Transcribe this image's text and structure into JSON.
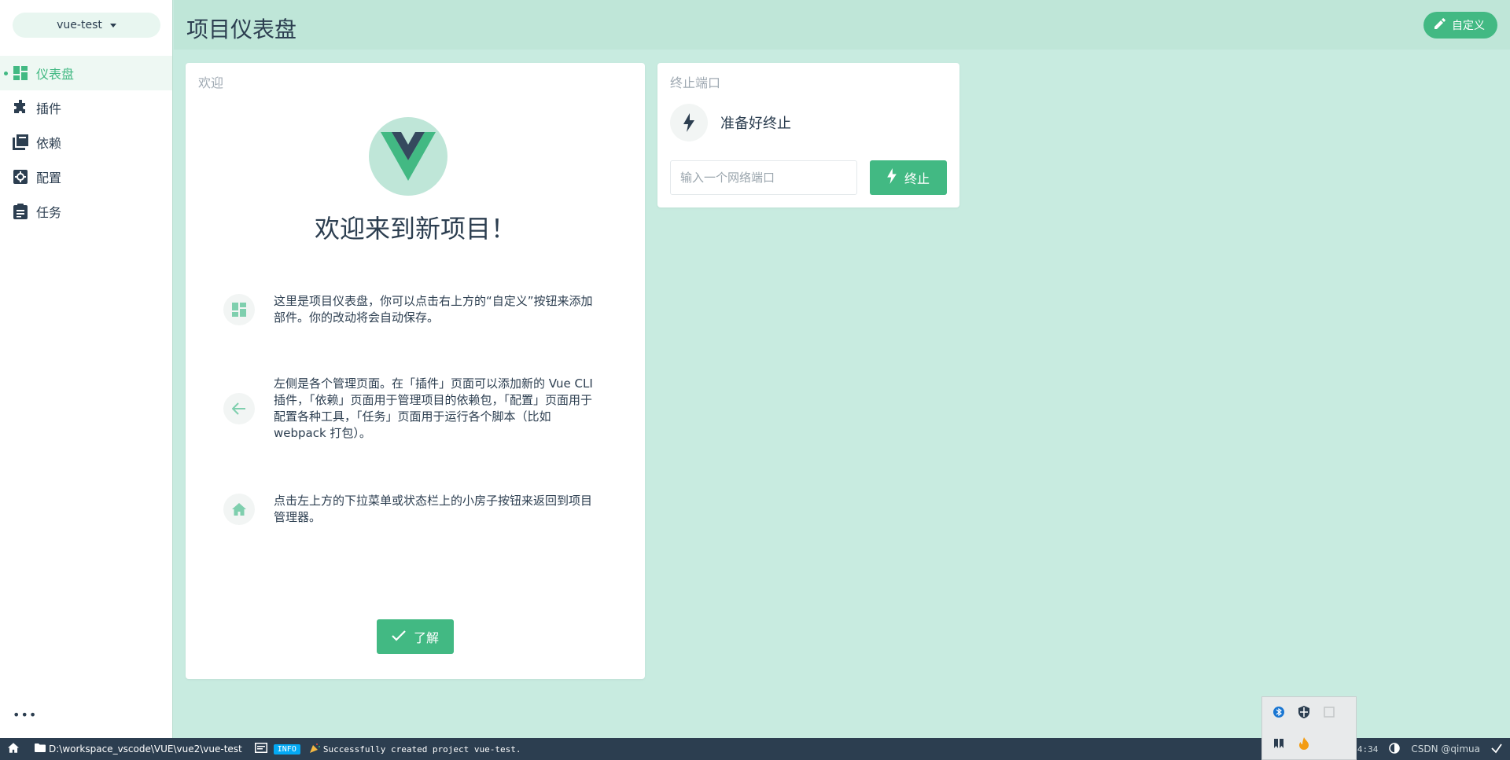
{
  "sidebar": {
    "project": "vue-test",
    "items": [
      {
        "label": "仪表盘",
        "icon": "dashboard-icon",
        "active": true
      },
      {
        "label": "插件",
        "icon": "puzzle-icon",
        "active": false
      },
      {
        "label": "依赖",
        "icon": "library-icon",
        "active": false
      },
      {
        "label": "配置",
        "icon": "settings-icon",
        "active": false
      },
      {
        "label": "任务",
        "icon": "clipboard-icon",
        "active": false
      }
    ],
    "more": "•••"
  },
  "header": {
    "title": "项目仪表盘",
    "customize_label": "自定义"
  },
  "welcome": {
    "card_title": "欢迎",
    "heading": "欢迎来到新项目！",
    "tips": [
      {
        "icon": "dashboard-icon",
        "text": "这里是项目仪表盘，你可以点击右上方的“自定义”按钮来添加部件。你的改动将会自动保存。"
      },
      {
        "icon": "arrow-left-icon",
        "text": "左侧是各个管理页面。在「插件」页面可以添加新的 Vue CLI 插件，「依赖」页面用于管理项目的依赖包，「配置」页面用于配置各种工具，「任务」页面用于运行各个脚本（比如 webpack 打包）。"
      },
      {
        "icon": "home-icon",
        "text": "点击左上方的下拉菜单或状态栏上的小房子按钮来返回到项目管理器。"
      }
    ],
    "ok_label": "了解"
  },
  "kill_port": {
    "card_title": "终止端口",
    "status": "准备好终止",
    "input_placeholder": "输入一个网络端口",
    "kill_label": "终止"
  },
  "statusbar": {
    "path": "D:\\workspace_vscode\\VUE\\vue2\\vue-test",
    "log_level": "INFO",
    "log_message": "Successfully created project vue-test.",
    "time": "16:54:34",
    "watermark": "CSDN @qimua"
  },
  "colors": {
    "accent": "#42b983",
    "background": "#c8ebe0",
    "text": "#2c3e50",
    "statusbar": "#2c3e50"
  }
}
